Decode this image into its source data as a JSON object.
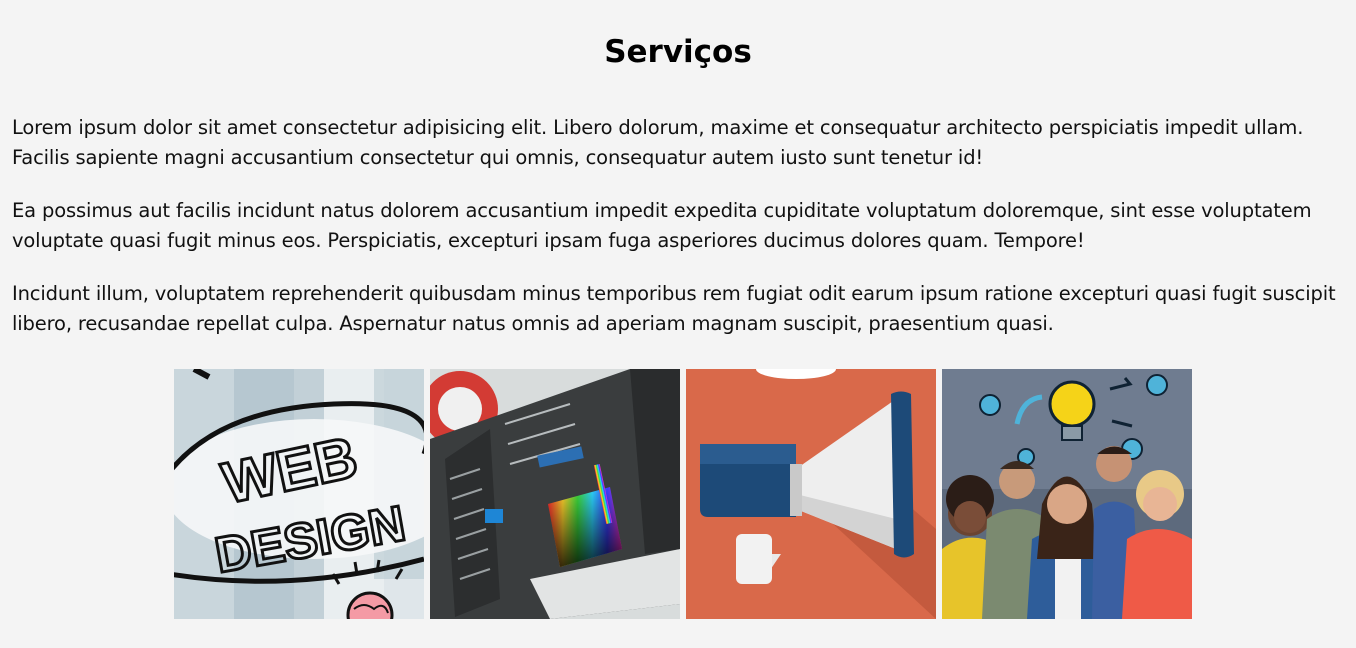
{
  "section": {
    "title": "Serviços",
    "paragraphs": [
      "Lorem ipsum dolor sit amet consectetur adipisicing elit. Libero dolorum, maxime et consequatur architecto perspiciatis impedit ullam. Facilis sapiente magni accusantium consectetur qui omnis, consequatur autem iusto sunt tenetur id!",
      "Ea possimus aut facilis incidunt natus dolorem accusantium impedit expedita cupiditate voluptatum doloremque, sint esse voluptatem voluptate quasi fugit minus eos. Perspiciatis, excepturi ipsam fuga asperiores ducimus dolores quam. Tempore!",
      "Incidunt illum, voluptatem reprehenderit quibusdam minus temporibus rem fugiat odit earum ipsum ratione excepturi quasi fugit suscipit libero, recusandae repellat culpa. Aspernatur natus omnis ad aperiam magnam suscipit, praesentium quasi."
    ]
  },
  "gallery": {
    "images": [
      {
        "icon": "web-design-image",
        "text_lines": [
          "WEB",
          "DESIGN"
        ]
      },
      {
        "icon": "graphic-editor-image"
      },
      {
        "icon": "megaphone-image"
      },
      {
        "icon": "team-ideas-image"
      }
    ]
  },
  "colors": {
    "background": "#f4f4f4",
    "text": "#111111",
    "megaphone_bg": "#d9694a",
    "megaphone_blue": "#1d4a78"
  }
}
